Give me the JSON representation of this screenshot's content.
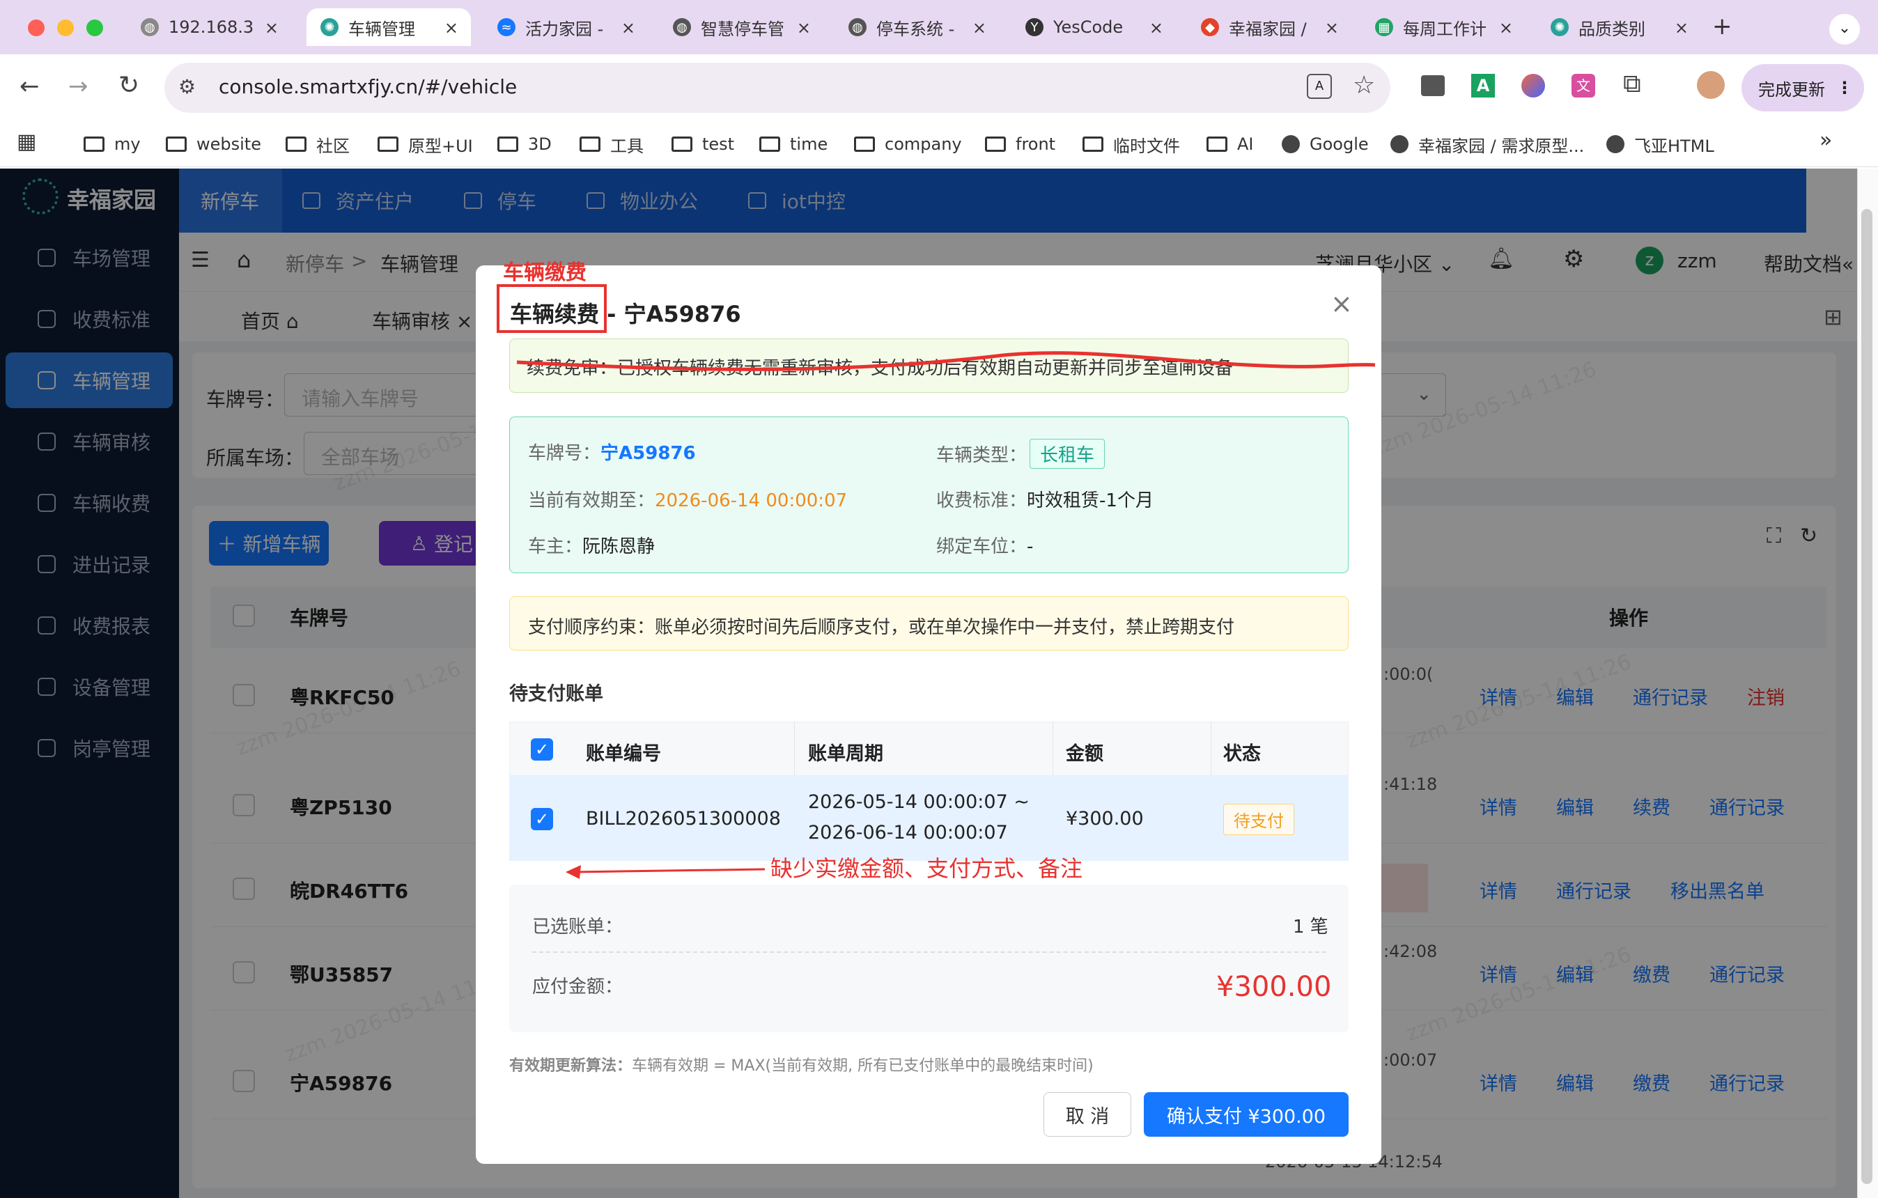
{
  "browser": {
    "tabs": [
      {
        "title": "192.168.3",
        "color": "#888",
        "glyph": "◍"
      },
      {
        "title": "车辆管理",
        "color": "#2aa198",
        "glyph": "✺"
      },
      {
        "title": "活力家园 -",
        "color": "#1677ff",
        "glyph": "≈"
      },
      {
        "title": "智慧停车管",
        "color": "#555",
        "glyph": "◍"
      },
      {
        "title": "停车系统 -",
        "color": "#555",
        "glyph": "◍"
      },
      {
        "title": "YesCode",
        "color": "#333",
        "glyph": "Y"
      },
      {
        "title": "幸福家园 /",
        "color": "#e24329",
        "glyph": "◆"
      },
      {
        "title": "每周工作计",
        "color": "#21a366",
        "glyph": "▦"
      },
      {
        "title": "品质类别",
        "color": "#2aa198",
        "glyph": "✺"
      }
    ],
    "new_tab": "+",
    "url": "console.smartxfjy.cn/#/vehicle",
    "update_button": "完成更新",
    "bookmarks": [
      {
        "label": "my",
        "type": "folder"
      },
      {
        "label": "website",
        "type": "folder"
      },
      {
        "label": "社区",
        "type": "folder"
      },
      {
        "label": "原型+UI",
        "type": "folder"
      },
      {
        "label": "3D",
        "type": "folder"
      },
      {
        "label": "工具",
        "type": "folder"
      },
      {
        "label": "test",
        "type": "folder"
      },
      {
        "label": "time",
        "type": "folder"
      },
      {
        "label": "company",
        "type": "folder"
      },
      {
        "label": "front",
        "type": "folder"
      },
      {
        "label": "临时文件",
        "type": "folder"
      },
      {
        "label": "AI",
        "type": "folder"
      },
      {
        "label": "Google",
        "type": "site"
      },
      {
        "label": "幸福家园 / 需求原型...",
        "type": "site"
      },
      {
        "label": "飞亚HTML",
        "type": "site"
      }
    ],
    "more": "»"
  },
  "app": {
    "logo": "幸福家园",
    "sidebar": [
      "车场管理",
      "收费标准",
      "车辆管理",
      "车辆审核",
      "车辆收费",
      "进出记录",
      "收费报表",
      "设备管理",
      "岗亭管理"
    ],
    "topnav": [
      "新停车",
      "资产住户",
      "停车",
      "物业办公",
      "iot中控"
    ],
    "breadcrumb": [
      "新停车",
      ">",
      "车辆管理"
    ],
    "community": "芝澜月华小区",
    "user": "zzm",
    "avatar_letter": "z",
    "help": "帮助文档",
    "page_tabs": [
      "首页",
      "车辆审核"
    ],
    "filter": {
      "plate_label": "车牌号：",
      "plate_placeholder": "请输入车牌号",
      "lot_label": "所属车场：",
      "lot_placeholder": "全部车场"
    },
    "buttons": {
      "add": "新增车辆",
      "register": "登记"
    },
    "table_header": {
      "plate": "车牌号",
      "ops": "操作"
    },
    "rows": [
      {
        "plate": "粤RKFC50",
        "time": ":00:0(",
        "ops": [
          "详情",
          "编辑",
          "通行记录",
          "注销"
        ]
      },
      {
        "plate": "粤ZP5130",
        "time": ":41:18",
        "ops": [
          "详情",
          "编辑",
          "续费",
          "通行记录"
        ]
      },
      {
        "plate": "皖DR46TT6",
        "time": "",
        "ops": [
          "详情",
          "通行记录",
          "移出黑名单"
        ]
      },
      {
        "plate": "鄂U35857",
        "time": ":42:08",
        "ops": [
          "详情",
          "编辑",
          "缴费",
          "通行记录"
        ]
      },
      {
        "plate": "宁A59876",
        "time": ":00:07",
        "ops": [
          "详情",
          "编辑",
          "缴费",
          "通行记录"
        ]
      }
    ],
    "bottom_time": "2026-05-13 14:12:54",
    "watermark": "zzm 2026-05-14 11:26"
  },
  "modal": {
    "annotation_title": "车辆缴费",
    "title_highlight": "车辆续费",
    "title_rest": " - 宁A59876",
    "notice": "续费免审：已授权车辆续费无需重新审核，支付成功后有效期自动更新并同步至道闸设备",
    "info": {
      "plate_label": "车牌号：",
      "plate": "宁A59876",
      "type_label": "车辆类型：",
      "type": "长租车",
      "expiry_label": "当前有效期至：",
      "expiry": "2026-06-14 00:00:07",
      "standard_label": "收费标准：",
      "standard": "时效租赁-1个月",
      "owner_label": "车主：",
      "owner": "阮陈恩静",
      "space_label": "绑定车位：",
      "space": "-"
    },
    "warning": "支付顺序约束：账单必须按时间先后顺序支付，或在单次操作中一并支付，禁止跨期支付",
    "bills_title": "待支付账单",
    "columns": [
      "账单编号",
      "账单周期",
      "金额",
      "状态"
    ],
    "bill": {
      "id": "BILL2026051300008",
      "period_start": "2026-05-14 00:00:07 ~",
      "period_end": "2026-06-14 00:00:07",
      "amount": "¥300.00",
      "status": "待支付"
    },
    "annotation_missing": "缺少实缴金额、支付方式、备注",
    "summary": {
      "selected_label": "已选账单：",
      "selected": "1 笔",
      "due_label": "应付金额：",
      "due": "¥300.00"
    },
    "formula_label": "有效期更新算法：",
    "formula": "车辆有效期 = MAX(当前有效期, 所有已支付账单中的最晚结束时间)",
    "cancel": "取 消",
    "confirm": "确认支付 ¥300.00"
  }
}
